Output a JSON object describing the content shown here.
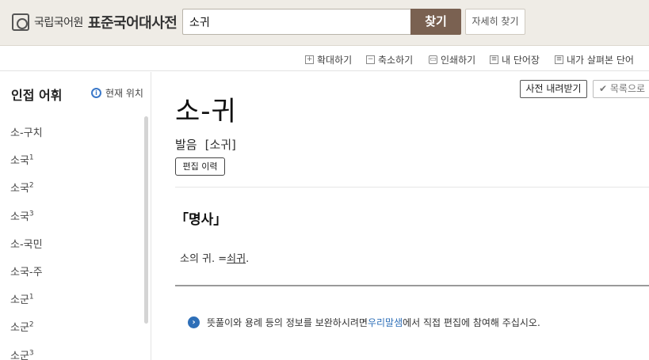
{
  "header": {
    "org_name": "국립국어원",
    "dict_title": "표준국어대사전",
    "search_value": "소귀",
    "search_button": "찾기",
    "detail_button": "자세히 찾기"
  },
  "toolbar": {
    "zoom_in": "확대하기",
    "zoom_out": "축소하기",
    "print": "인쇄하기",
    "my_words": "내 단어장",
    "viewed_words": "내가 살펴본 단어"
  },
  "sidebar": {
    "title": "인접 어휘",
    "current_position": "현재 위치",
    "items": [
      {
        "label": "소-구치",
        "sup": ""
      },
      {
        "label": "소국",
        "sup": "1"
      },
      {
        "label": "소국",
        "sup": "2"
      },
      {
        "label": "소국",
        "sup": "3"
      },
      {
        "label": "소-국민",
        "sup": ""
      },
      {
        "label": "소국-주",
        "sup": ""
      },
      {
        "label": "소군",
        "sup": "1"
      },
      {
        "label": "소군",
        "sup": "2"
      },
      {
        "label": "소군",
        "sup": "3"
      }
    ]
  },
  "main": {
    "download_button": "사전 내려받기",
    "list_button": "✔ 목록으로",
    "entry_word": "소-귀",
    "pron_label": "발음",
    "pron_value": "[소귀]",
    "edit_history": "편집 이력",
    "part_of_speech": "「명사」",
    "definition_text": "소의 귀. =",
    "definition_link": "쇠귀",
    "definition_end": ".",
    "notice_pre": "뜻풀이와 용례 등의 정보를 보완하시려면 ",
    "notice_link": "우리말샘",
    "notice_post": "에서 직접 편집에 참여해 주십시오."
  },
  "colors": {
    "header_bg": "#efece6",
    "search_button_bg": "#7a6151",
    "link_blue": "#2e6fb8"
  }
}
